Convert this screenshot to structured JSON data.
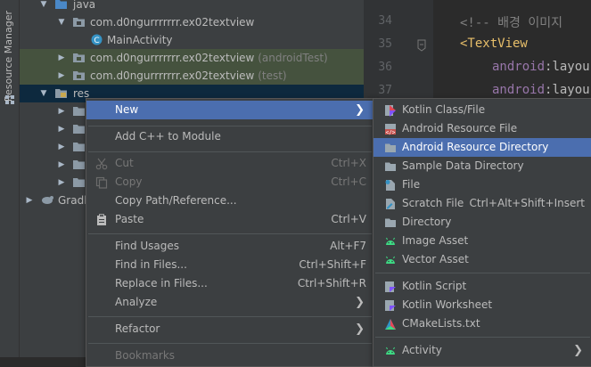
{
  "tool_strip": {
    "label": "Resource Manager"
  },
  "tree": [
    {
      "label": "java",
      "suffix": ""
    },
    {
      "label": "com.d0ngurrrrrrr.ex02textview",
      "suffix": ""
    },
    {
      "label": "MainActivity",
      "suffix": ""
    },
    {
      "label": "com.d0ngurrrrrrr.ex02textview",
      "suffix": "(androidTest)"
    },
    {
      "label": "com.d0ngurrrrrrr.ex02textview",
      "suffix": "(test)"
    },
    {
      "label": "res",
      "suffix": ""
    },
    {
      "label": "Gradl",
      "suffix": ""
    }
  ],
  "editor": {
    "lines": [
      "34",
      "35",
      "36",
      "37"
    ],
    "comment": "<!-- 배경 이미지",
    "tag": "<TextView",
    "attr1_ns": "android",
    "attr1_rest": ":layou",
    "attr2_ns": "android",
    "attr2_rest": ":layou"
  },
  "context_menu": {
    "new": "New",
    "add_cpp": "Add C++ to Module",
    "cut": "Cut",
    "cut_sc": "Ctrl+X",
    "copy": "Copy",
    "copy_sc": "Ctrl+C",
    "copy_path": "Copy Path/Reference...",
    "paste": "Paste",
    "paste_sc": "Ctrl+V",
    "find_usages": "Find Usages",
    "find_usages_sc": "Alt+F7",
    "find_in_files": "Find in Files...",
    "find_in_files_sc": "Ctrl+Shift+F",
    "replace_in_files": "Replace in Files...",
    "replace_in_files_sc": "Ctrl+Shift+R",
    "analyze": "Analyze",
    "refactor": "Refactor",
    "bookmarks": "Bookmarks"
  },
  "submenu": {
    "kotlin_class": "Kotlin Class/File",
    "android_resource_file": "Android Resource File",
    "android_resource_directory": "Android Resource Directory",
    "sample_data_directory": "Sample Data Directory",
    "file": "File",
    "scratch_file": "Scratch File",
    "scratch_file_sc": "Ctrl+Alt+Shift+Insert",
    "directory": "Directory",
    "image_asset": "Image Asset",
    "vector_asset": "Vector Asset",
    "kotlin_script": "Kotlin Script",
    "kotlin_worksheet": "Kotlin Worksheet",
    "cmakelists": "CMakeLists.txt",
    "activity": "Activity"
  },
  "colors": {
    "accent_selected": "#4b6eaf",
    "tree_selected": "#0d293e",
    "tree_test_bg": "#45523e",
    "android_green": "#3ddc84"
  }
}
